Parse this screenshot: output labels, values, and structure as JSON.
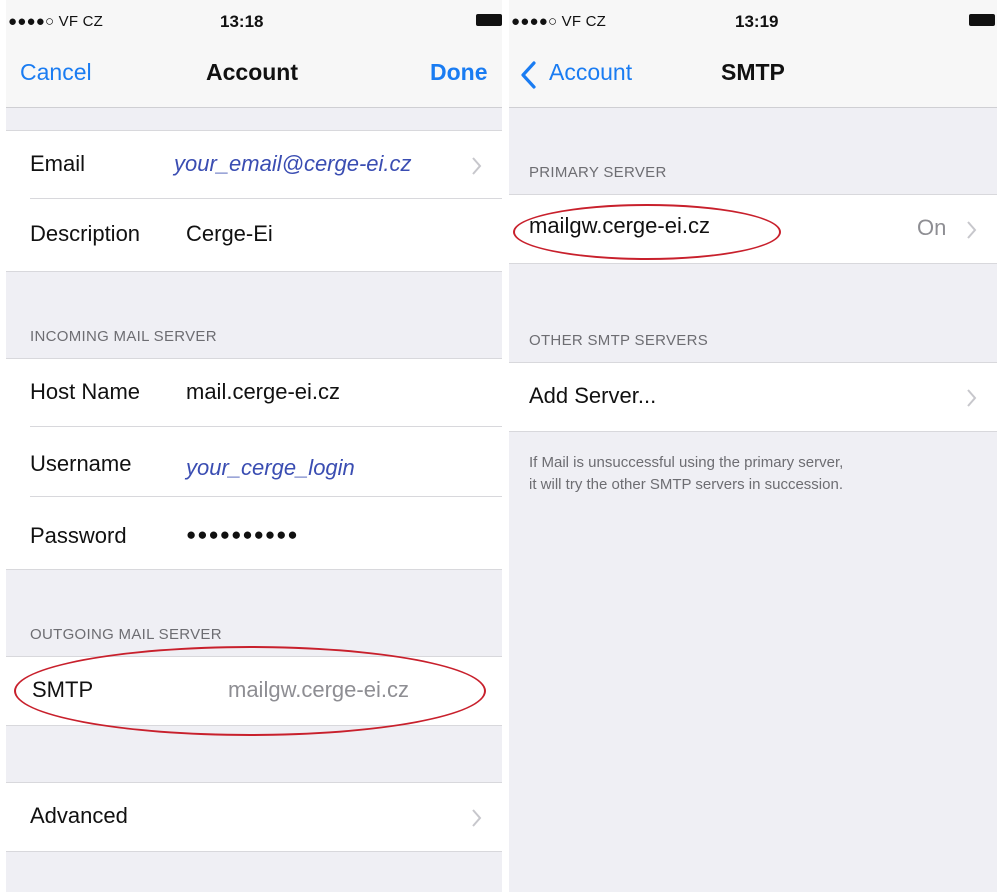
{
  "left": {
    "status": {
      "carrier": "●●●●○ VF CZ",
      "time": "13:18"
    },
    "nav": {
      "cancel": "Cancel",
      "title": "Account",
      "done": "Done"
    },
    "account": {
      "email_label": "Email",
      "email_value": "your_email@cerge-ei.cz",
      "description_label": "Description",
      "description_value": "Cerge-Ei"
    },
    "incoming": {
      "header": "INCOMING MAIL SERVER",
      "host_label": "Host Name",
      "host_value": "mail.cerge-ei.cz",
      "username_label": "Username",
      "username_value": "your_cerge_login",
      "password_label": "Password",
      "password_value": "●●●●●●●●●●"
    },
    "outgoing": {
      "header": "OUTGOING MAIL SERVER",
      "smtp_label": "SMTP",
      "smtp_value": "mailgw.cerge-ei.cz"
    },
    "advanced": {
      "label": "Advanced"
    }
  },
  "right": {
    "status": {
      "carrier": "●●●●○ VF CZ",
      "time": "13:19"
    },
    "nav": {
      "back": "Account",
      "title": "SMTP"
    },
    "primary": {
      "header": "PRIMARY SERVER",
      "server": "mailgw.cerge-ei.cz",
      "state": "On"
    },
    "other": {
      "header": "OTHER SMTP SERVERS",
      "add": "Add Server..."
    },
    "footnote_line1": "If Mail is unsuccessful using the primary server,",
    "footnote_line2": "it will try the other SMTP servers in succession."
  },
  "colors": {
    "tint": "#1a7cf2",
    "annotation": "#c8202c",
    "italic_value": "#3a4db2"
  }
}
